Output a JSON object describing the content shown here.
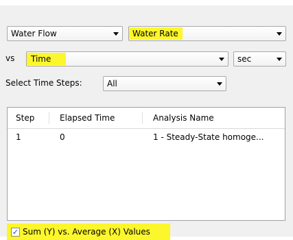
{
  "selectors": {
    "y_category": "Water Flow",
    "y_quantity": "Water Rate",
    "vs_label": "vs",
    "x_quantity": "Time",
    "x_unit": "sec",
    "time_steps_label": "Select Time Steps:",
    "time_steps_value": "All"
  },
  "table": {
    "headers": [
      "Step",
      "Elapsed Time",
      "Analysis Name"
    ],
    "rows": [
      [
        "1",
        "0",
        "1 - Steady-State homoge..."
      ]
    ]
  },
  "options": {
    "sum_avg_label": "Sum (Y) vs. Average (X) Values",
    "sum_avg_checked": true
  },
  "colors": {
    "highlight": "#fcf62c",
    "check": "#1a4da0"
  },
  "icons": {
    "dropdown": "chevron-down-icon",
    "check": "checkmark-icon"
  }
}
